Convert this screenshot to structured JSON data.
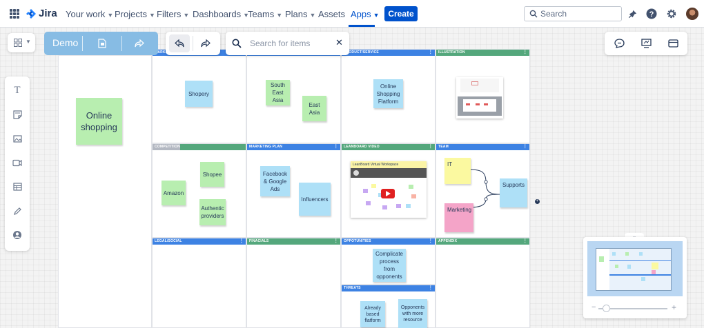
{
  "nav": {
    "logo_text": "Jira",
    "items": [
      {
        "label": "Your work",
        "chevron": true
      },
      {
        "label": "Projects",
        "chevron": true
      },
      {
        "label": "Filters",
        "chevron": true
      },
      {
        "label": "Dashboards",
        "chevron": true
      },
      {
        "label": "Teams",
        "chevron": true
      },
      {
        "label": "Plans",
        "chevron": true
      },
      {
        "label": "Assets",
        "chevron": false
      },
      {
        "label": "Apps",
        "chevron": true,
        "active": true
      }
    ],
    "create_label": "Create",
    "search_placeholder": "Search",
    "icons": [
      "notifications-icon",
      "help-icon",
      "settings-icon",
      "avatar"
    ]
  },
  "board_toolbar": {
    "board_name": "Demo",
    "search_placeholder": "Search for items",
    "left_tools": [
      "text-tool-icon",
      "sticky-note-tool-icon",
      "image-tool-icon",
      "video-tool-icon",
      "table-tool-icon",
      "pen-tool-icon",
      "person-tool-icon"
    ],
    "right_tools": [
      "comments-icon",
      "presentation-icon",
      "layout-icon"
    ]
  },
  "colors": {
    "header_blue": "#3d82e3",
    "header_green": "#54a77c",
    "note_blue": "#aee0f7",
    "note_green": "#b8eeb0",
    "note_yellow": "#fbf9a0",
    "note_pink": "#f4a4c8",
    "accent": "#0052cc"
  },
  "board": {
    "main_note": "Online shopping",
    "row1": {
      "cell_a": {
        "header": "MARKET",
        "notes": [
          "Shopery"
        ]
      },
      "cell_b": {
        "header": "",
        "notes": [
          "South East Asia",
          "East Asia"
        ]
      },
      "cell_c": {
        "header": "PRODUCT/SERVICE",
        "notes": [
          "Online Shopping Flatform"
        ]
      },
      "cell_d": {
        "header": "ILLUSTRATION"
      }
    },
    "row2": {
      "cell_a": {
        "header": "COMPETITIONS",
        "notes": [
          "Shopee",
          "Amazon",
          "Authentic providers"
        ]
      },
      "cell_b": {
        "header": "MARKETING PLAN",
        "notes": [
          "Facebook & Google Ads",
          "Influencers"
        ]
      },
      "cell_c": {
        "header": "LEANBOARD VIDEO",
        "video_title": "LeanBoard Virtual Workspace"
      },
      "cell_d": {
        "header": "TEAM",
        "notes": [
          "IT",
          "Marketing",
          "Supports"
        ]
      }
    },
    "row3": {
      "cell_a": {
        "header": "LEGAL/SOCIAL"
      },
      "cell_b": {
        "header": "FINACIALS"
      },
      "cell_c": {
        "header": "OPPOTUNITIES",
        "notes": [
          "Complicate process from opponents"
        ]
      },
      "cell_d": {
        "header": "APPENDIX"
      }
    },
    "row4": {
      "cell_c": {
        "header": "THREATS",
        "notes": [
          "Already based flatform",
          "Opponents with more resource"
        ]
      }
    }
  },
  "minimap": {
    "zoom": 0.1
  }
}
